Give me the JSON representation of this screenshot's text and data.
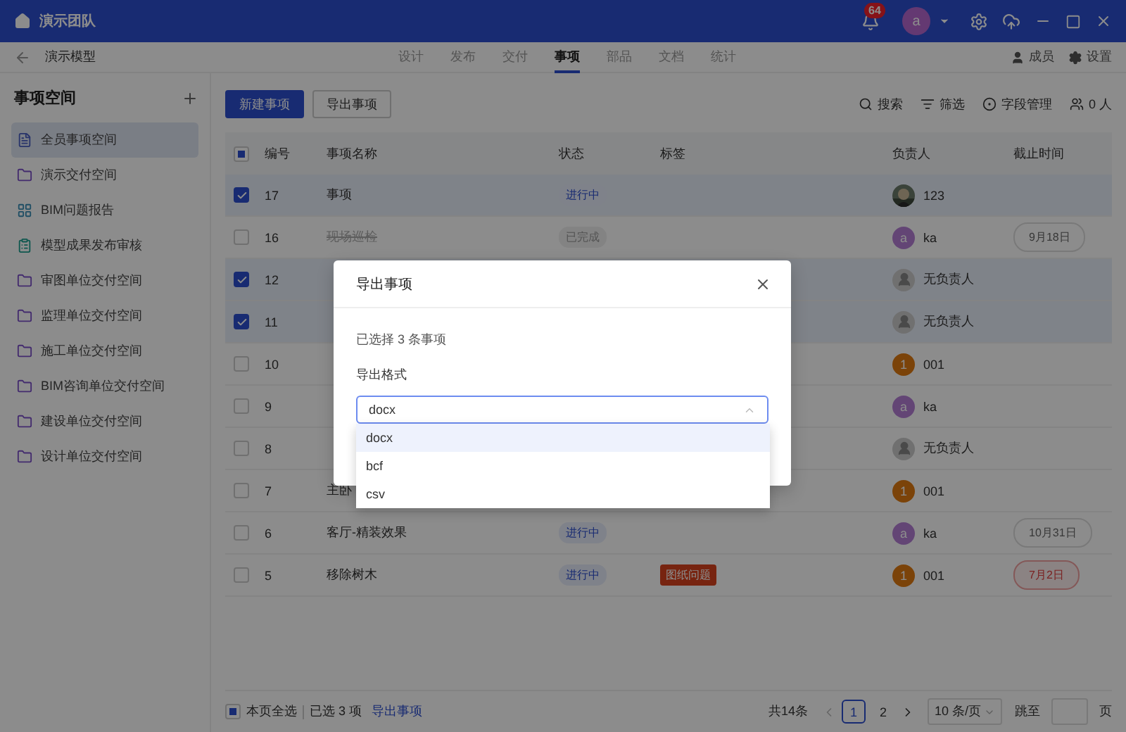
{
  "topbar": {
    "team": "演示团队",
    "notifications": "64",
    "avatar": "a"
  },
  "subbar": {
    "project": "演示模型",
    "tabs": [
      {
        "label": "设计",
        "selected": false
      },
      {
        "label": "发布",
        "selected": false
      },
      {
        "label": "交付",
        "selected": false
      },
      {
        "label": "事项",
        "selected": true
      },
      {
        "label": "部品",
        "selected": false
      },
      {
        "label": "文档",
        "selected": false
      },
      {
        "label": "统计",
        "selected": false
      }
    ],
    "actions": [
      {
        "label": "成员",
        "kind": "members"
      },
      {
        "label": "设置",
        "kind": "settings"
      }
    ]
  },
  "sidebar": {
    "title": "事项空间",
    "items": [
      {
        "label": "全员事项空间",
        "kind": "doc",
        "selected": true
      },
      {
        "label": "演示交付空间",
        "kind": "folder",
        "selected": false
      },
      {
        "label": "BIM问题报告",
        "kind": "board",
        "selected": false
      },
      {
        "label": "模型成果发布审核",
        "kind": "clipboard",
        "selected": false
      },
      {
        "label": "审图单位交付空间",
        "kind": "folder",
        "selected": false
      },
      {
        "label": "监理单位交付空间",
        "kind": "folder",
        "selected": false
      },
      {
        "label": "施工单位交付空间",
        "kind": "folder",
        "selected": false
      },
      {
        "label": "BIM咨询单位交付空间",
        "kind": "folder",
        "selected": false
      },
      {
        "label": "建设单位交付空间",
        "kind": "folder",
        "selected": false
      },
      {
        "label": "设计单位交付空间",
        "kind": "folder",
        "selected": false
      }
    ]
  },
  "toolbar": {
    "buttons": [
      {
        "label": "新建事项",
        "kind": "primary"
      },
      {
        "label": "导出事项",
        "kind": "default"
      }
    ],
    "tools": [
      {
        "label": "搜索",
        "kind": "search"
      },
      {
        "label": "筛选",
        "kind": "filter"
      },
      {
        "label": "字段管理",
        "kind": "fields"
      },
      {
        "label": "0 人",
        "kind": "people"
      }
    ]
  },
  "table": {
    "select_all_partial": true,
    "columns": [
      "编号",
      "事项名称",
      "状态",
      "标签",
      "负责人",
      "截止时间"
    ],
    "rows": [
      {
        "id": "17",
        "name": "事项",
        "completed": false,
        "checked": true,
        "status": {
          "text": "进行中",
          "kind": "active"
        },
        "owner": {
          "name": "123"
        }
      },
      {
        "id": "16",
        "name": "现场巡检",
        "completed": true,
        "checked": false,
        "status": {
          "text": "已完成",
          "kind": "done"
        },
        "owner": {
          "kind": "user",
          "text": "a",
          "name": "ka"
        },
        "deadline": {
          "text": "9月18日",
          "kind": "normal"
        }
      },
      {
        "id": "12",
        "checked": true,
        "owner": {
          "kind": "none",
          "name": "无负责人"
        }
      },
      {
        "id": "11",
        "checked": true,
        "owner": {
          "kind": "none",
          "name": "无负责人"
        }
      },
      {
        "id": "10",
        "checked": false,
        "owner": {
          "kind": "numbered",
          "text": "1",
          "name": "001"
        }
      },
      {
        "id": "9",
        "checked": false,
        "owner": {
          "kind": "user",
          "text": "a",
          "name": "ka"
        }
      },
      {
        "id": "8",
        "checked": false,
        "owner": {
          "kind": "none",
          "name": "无负责人"
        }
      },
      {
        "id": "7",
        "name": "主卧",
        "checked": false,
        "completed": false,
        "owner": {
          "kind": "numbered",
          "text": "1",
          "name": "001"
        }
      },
      {
        "id": "6",
        "name": "客厅-精装效果",
        "checked": false,
        "completed": false,
        "status": {
          "text": "进行中",
          "kind": "active"
        },
        "owner": {
          "kind": "user",
          "text": "a",
          "name": "ka"
        },
        "deadline": {
          "text": "10月31日",
          "kind": "normal"
        }
      },
      {
        "id": "5",
        "name": "移除树木",
        "checked": false,
        "completed": false,
        "status": {
          "text": "进行中",
          "kind": "active"
        },
        "tag": "图纸问题",
        "owner": {
          "kind": "numbered",
          "text": "1",
          "name": "001"
        },
        "deadline": {
          "text": "7月2日",
          "kind": "overdue"
        }
      }
    ]
  },
  "footer": {
    "select_all_partial": true,
    "select_all": "本页全选",
    "selected_count": "已选 3 项",
    "export_link": "导出事项",
    "total": "共14条",
    "pages": [
      {
        "label": "1",
        "selected": true
      },
      {
        "label": "2",
        "selected": false
      }
    ],
    "page_size": "10 条/页",
    "jump_label": "跳至",
    "page_unit": "页"
  },
  "dialog": {
    "title": "导出事项",
    "summary": "已选择 3 条事项",
    "format_label": "导出格式",
    "format_value": "docx",
    "options": [
      {
        "label": "docx",
        "selected": true
      },
      {
        "label": "bcf",
        "selected": false
      },
      {
        "label": "csv",
        "selected": false
      }
    ]
  }
}
